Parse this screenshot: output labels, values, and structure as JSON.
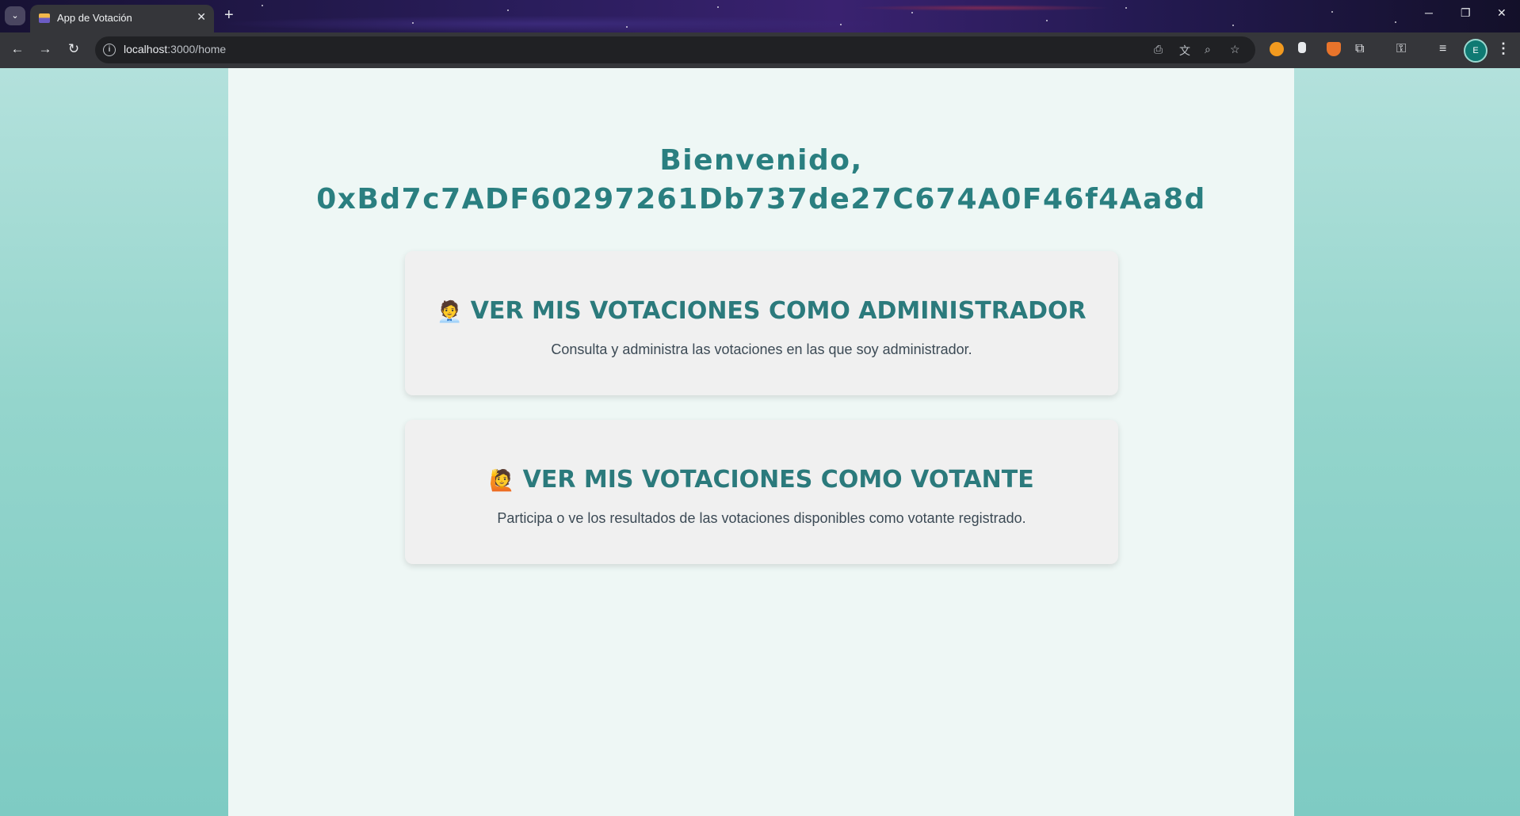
{
  "browser": {
    "tab_title": "App de Votación",
    "tab_close": "✕",
    "new_tab": "+",
    "url_host": "localhost",
    "url_rest": ":3000/home",
    "profile_initial": "E"
  },
  "page": {
    "welcome_line1": "Bienvenido,",
    "welcome_line2": "0xBd7c7ADF60297261Db737de27C674A0F46f4Aa8d",
    "cards": [
      {
        "emoji": "🧑‍💼",
        "title": "VER MIS VOTACIONES COMO ADMINISTRADOR",
        "description": "Consulta y administra las votaciones en las que soy administrador."
      },
      {
        "emoji": "🙋",
        "title": "VER MIS VOTACIONES COMO VOTANTE",
        "description": "Participa o ve los resultados de las votaciones disponibles como votante registrado."
      }
    ]
  },
  "colors": {
    "accent": "#2a7f80",
    "panel": "#eef7f5",
    "card": "#f0f0f0",
    "background_top": "#b3e1dc",
    "background_bottom": "#7ecbc3"
  }
}
